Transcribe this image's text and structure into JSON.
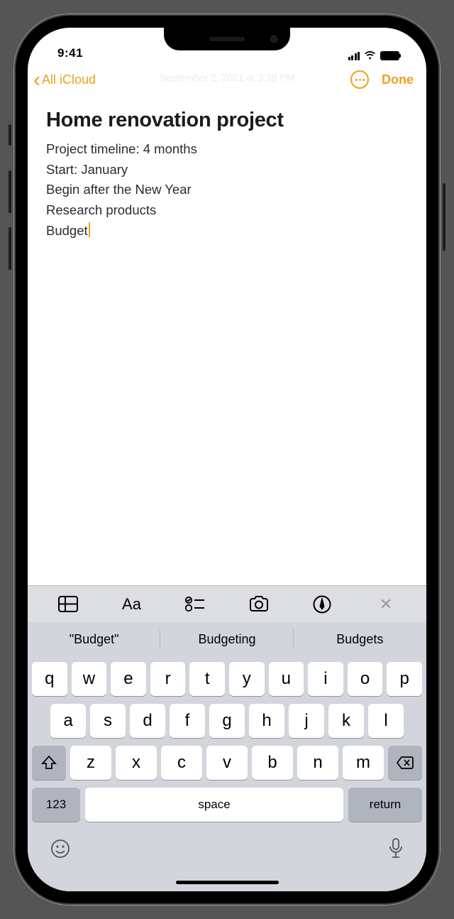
{
  "statusBar": {
    "time": "9:41"
  },
  "nav": {
    "back_label": "All iCloud",
    "done_label": "Done",
    "date_ghost": "September 2, 2021 at 3:39 PM"
  },
  "note": {
    "title": "Home renovation project",
    "lines": [
      "Project timeline: 4 months",
      "Start: January",
      "Begin after the New Year",
      "Research products",
      "Budget"
    ]
  },
  "suggestions": [
    "\"Budget\"",
    "Budgeting",
    "Budgets"
  ],
  "keyboard": {
    "row1": [
      "q",
      "w",
      "e",
      "r",
      "t",
      "y",
      "u",
      "i",
      "o",
      "p"
    ],
    "row2": [
      "a",
      "s",
      "d",
      "f",
      "g",
      "h",
      "j",
      "k",
      "l"
    ],
    "row3": [
      "z",
      "x",
      "c",
      "v",
      "b",
      "n",
      "m"
    ],
    "num_label": "123",
    "space_label": "space",
    "return_label": "return"
  }
}
